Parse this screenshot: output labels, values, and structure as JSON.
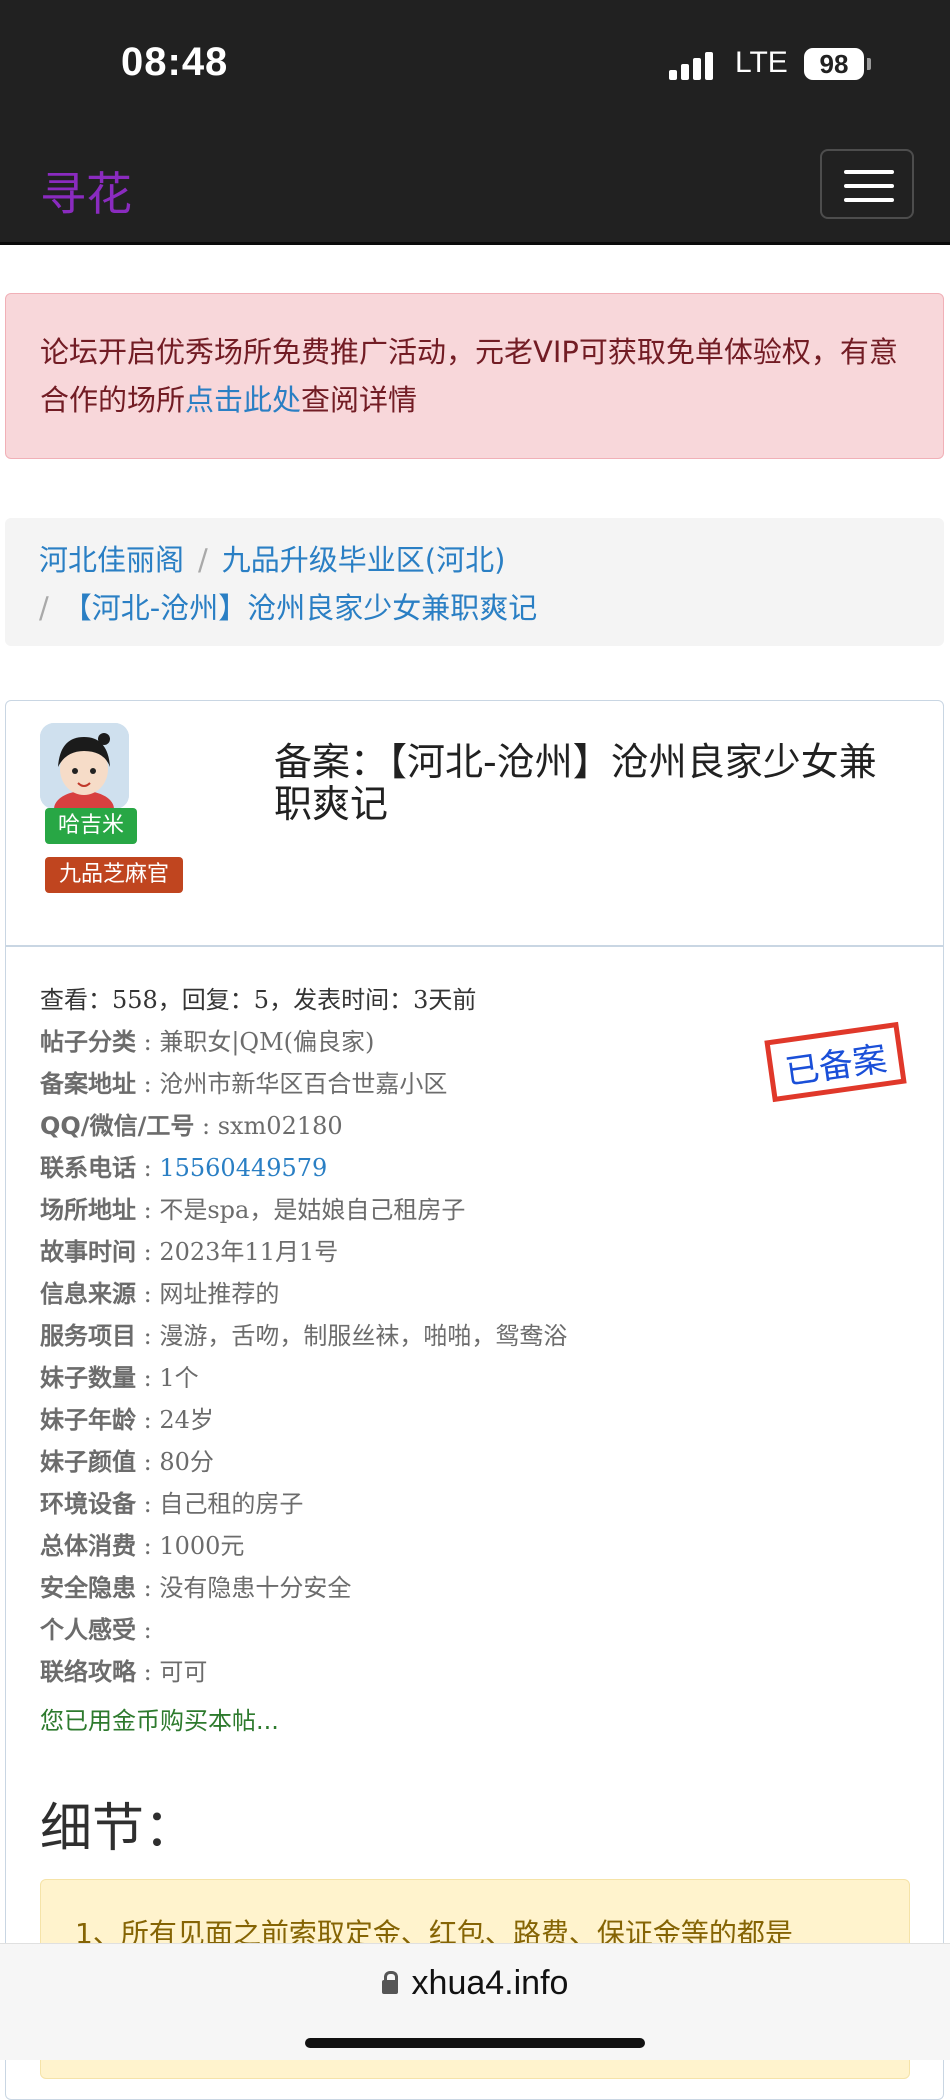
{
  "status_bar": {
    "time": "08:48",
    "network": "LTE",
    "battery": "98"
  },
  "navbar": {
    "brand": "寻花"
  },
  "alert": {
    "text_before": "论坛开启优秀场所免费推广活动，元老VIP可获取免单体验权，有意合作的场所",
    "link": "点击此处",
    "text_after": "查阅详情"
  },
  "breadcrumb": [
    "河北佳丽阁",
    "九品升级毕业区(河北)",
    "【河北-沧州】沧州良家少女兼职爽记"
  ],
  "separator": "/",
  "post": {
    "author": "哈吉米",
    "rank": "九品芝麻官",
    "title": "备案：【河北-沧州】沧州良家少女兼职爽记",
    "stats": "查看：558，回复：5，发表时间：3天前",
    "stamp": "已备案",
    "fields": [
      {
        "label": "帖子分类",
        "value": "兼职女|QM(偏良家)"
      },
      {
        "label": "备案地址",
        "value": "沧州市新华区百合世嘉小区"
      },
      {
        "label": "QQ/微信/工号",
        "value": "sxm02180"
      },
      {
        "label": "联系电话",
        "value": "15560449579",
        "link": true
      },
      {
        "label": "场所地址",
        "value": "不是spa，是姑娘自己租房子"
      },
      {
        "label": "故事时间",
        "value": "2023年11月1号"
      },
      {
        "label": "信息来源",
        "value": "网址推荐的"
      },
      {
        "label": "服务项目",
        "value": "漫游，舌吻，制服丝袜，啪啪，鸳鸯浴"
      },
      {
        "label": "妹子数量",
        "value": "1个"
      },
      {
        "label": "妹子年龄",
        "value": "24岁"
      },
      {
        "label": "妹子颜值",
        "value": "80分"
      },
      {
        "label": "环境设备",
        "value": "自己租的房子"
      },
      {
        "label": "总体消费",
        "value": "1000元"
      },
      {
        "label": "安全隐患",
        "value": "没有隐患十分安全"
      },
      {
        "label": "个人感受",
        "value": ""
      },
      {
        "label": "联络攻略",
        "value": "可可"
      }
    ],
    "purchased_note": "您已用金币购买本帖...",
    "details_heading": "细节：",
    "warning_text": "1、所有见面之前索取定金、红包、路费、保证金等的都是"
  },
  "browser": {
    "url": "xhua4.info"
  }
}
